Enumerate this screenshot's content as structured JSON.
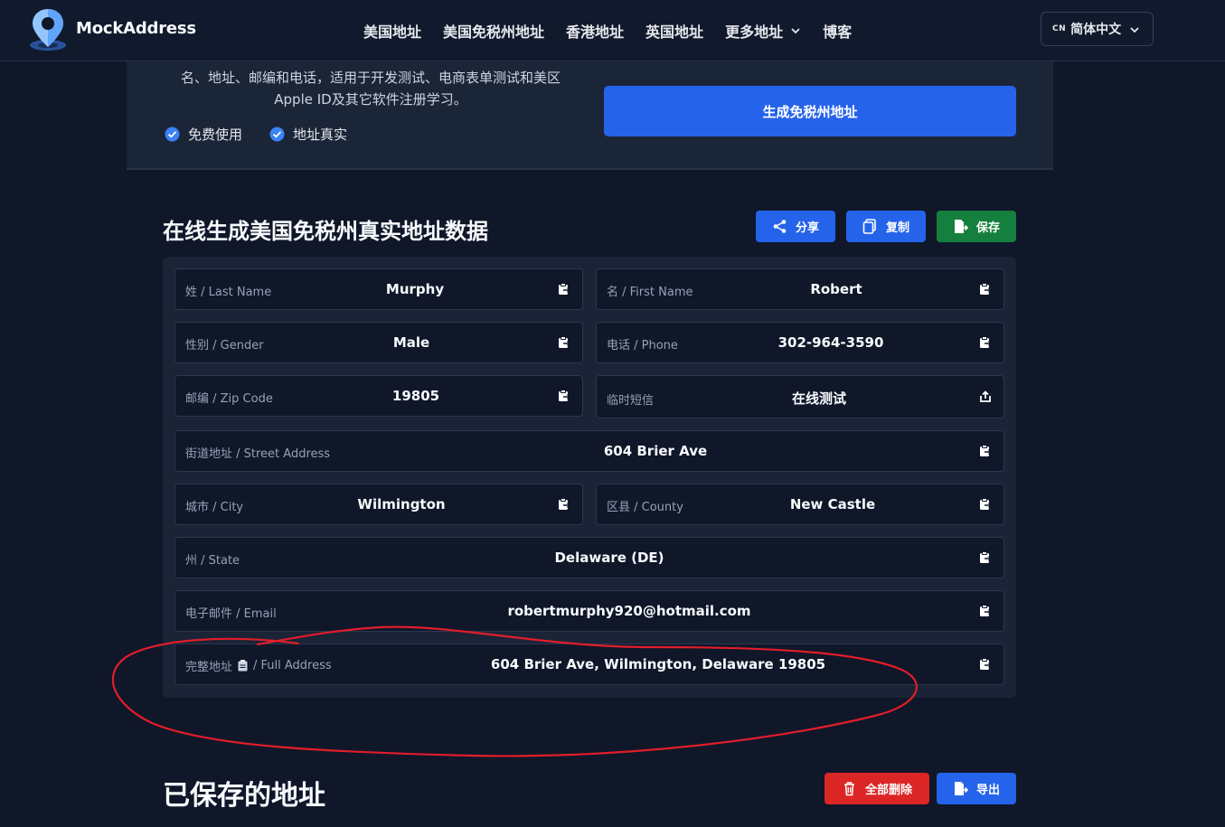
{
  "header": {
    "brand": "MockAddress",
    "nav": [
      "美国地址",
      "美国免税州地址",
      "香港地址",
      "英国地址",
      "更多地址",
      "博客"
    ],
    "lang_flag": "CN",
    "lang_label": "简体中文"
  },
  "hero": {
    "description_line1": "名、地址、邮编和电话，适用于开发测试、电商表单测试和美区",
    "description_line2": "Apple ID及其它软件注册学习。",
    "features": [
      "免费使用",
      "地址真实"
    ],
    "generate_button": "生成免税州地址"
  },
  "result": {
    "title": "在线生成美国免税州真实地址数据",
    "share_button": "分享",
    "copy_button": "复制",
    "save_button": "保存",
    "fields": {
      "last_name": {
        "label": "姓 / Last Name",
        "value": "Murphy"
      },
      "first_name": {
        "label": "名 / First Name",
        "value": "Robert"
      },
      "gender": {
        "label": "性别 / Gender",
        "value": "Male"
      },
      "phone": {
        "label": "电话 / Phone",
        "value": "302-964-3590"
      },
      "zip": {
        "label": "邮编 / Zip Code",
        "value": "19805"
      },
      "sms": {
        "label": "临时短信",
        "value": "在线测试"
      },
      "street": {
        "label": "街道地址 / Street Address",
        "value": "604 Brier Ave"
      },
      "city": {
        "label": "城市 / City",
        "value": "Wilmington"
      },
      "county": {
        "label": "区县 / County",
        "value": "New Castle"
      },
      "state": {
        "label": "州 / State",
        "value": "Delaware (DE)"
      },
      "email": {
        "label": "电子邮件 / Email",
        "value": "robertmurphy920@hotmail.com"
      },
      "full_address": {
        "label_cn": "完整地址",
        "label_en": "/ Full Address",
        "value": "604 Brier Ave, Wilmington, Delaware 19805"
      }
    }
  },
  "saved": {
    "title": "已保存的地址",
    "delete_all_button": "全部删除",
    "export_button": "导出"
  },
  "colors": {
    "background": "#0f1729",
    "primary": "#2563eb",
    "success": "#15803d",
    "danger": "#dc2626",
    "annotation": "#e11d2a"
  }
}
